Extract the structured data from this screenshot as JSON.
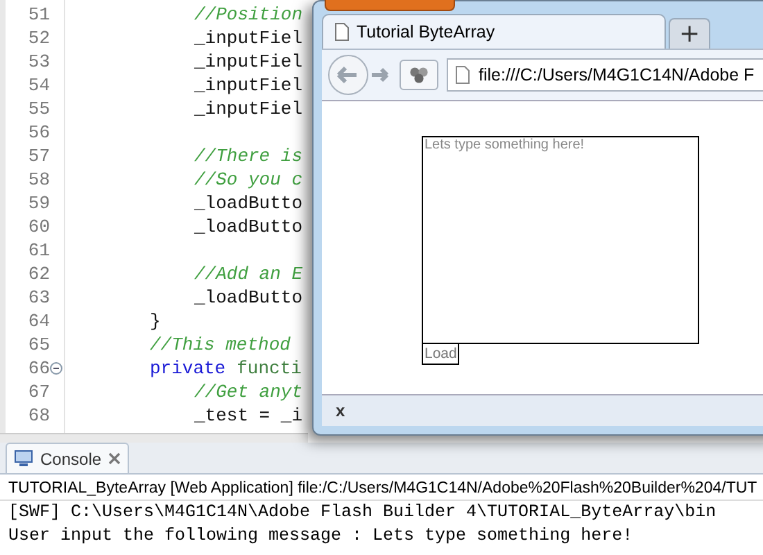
{
  "editor": {
    "lines": [
      {
        "children": [
          {
            "number": "51",
            "kind": "comment",
            "text": "//Position"
          },
          {
            "number": "52",
            "kind": "code",
            "text": "_inputFiel"
          },
          {
            "number": "53",
            "kind": "code",
            "text": "_inputFiel"
          },
          {
            "number": "54",
            "kind": "code",
            "text": "_inputFiel"
          },
          {
            "number": "55",
            "kind": "code",
            "text": "_inputFiel"
          },
          {
            "number": "56",
            "kind": "blank"
          },
          {
            "number": "57",
            "kind": "comment",
            "text": "//There is"
          },
          {
            "number": "58",
            "kind": "comment",
            "text": "//So you c"
          },
          {
            "number": "59",
            "kind": "code",
            "text": "_loadButto"
          },
          {
            "number": "60",
            "kind": "code",
            "text": "_loadButto"
          },
          {
            "number": "61",
            "kind": "blank"
          },
          {
            "number": "62",
            "kind": "comment",
            "text": "//Add an E"
          },
          {
            "number": "63",
            "kind": "code",
            "text": "_loadButto"
          }
        ]
      },
      {
        "number": "64",
        "kind": "code",
        "text": "}"
      },
      {
        "number": "65",
        "kind": "comment",
        "text": "//This method"
      },
      {
        "number": "66",
        "kind": "keyword",
        "text": "private",
        "rest": "functi",
        "fold": true,
        "children": [
          {
            "number": "67",
            "kind": "comment",
            "text": "//Get anyt"
          },
          {
            "number": "68",
            "kind": "code",
            "text": "_test = _i"
          }
        ]
      }
    ]
  },
  "browser": {
    "tab": {
      "title": "Tutorial ByteArray"
    },
    "new_tab": "+",
    "address": "file:///C:/Users/M4G1C14N/Adobe F",
    "page": {
      "input": {
        "placeholder": "Lets type something here!"
      },
      "button": "Load"
    },
    "bottom_bar": {
      "close": "x"
    }
  },
  "console": {
    "tab": "Console",
    "header": "TUTORIAL_ByteArray [Web Application] file:/C:/Users/M4G1C14N/Adobe%20Flash%20Builder%204/TUT",
    "lines": [
      "[SWF] C:\\Users\\M4G1C14N\\Adobe Flash Builder 4\\TUTORIAL_ByteArray\\bin",
      "User input the following message : Lets type something here!"
    ]
  }
}
